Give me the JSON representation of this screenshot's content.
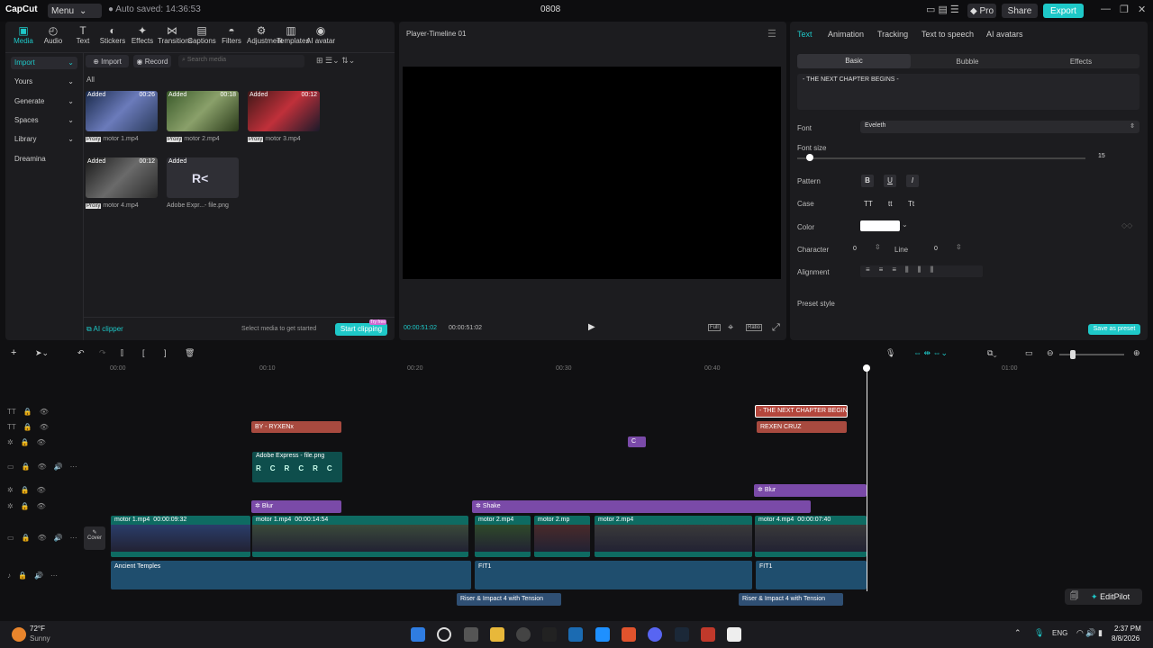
{
  "titlebar": {
    "app_name": "CapCut",
    "menu": "Menu",
    "autosave": "Auto saved: 14:36:53",
    "project": "0808",
    "pro": "Pro",
    "share": "Share",
    "export": "Export"
  },
  "tools": [
    {
      "label": "Media",
      "icon": "media-icon"
    },
    {
      "label": "Audio",
      "icon": "audio-icon"
    },
    {
      "label": "Text",
      "icon": "text-icon"
    },
    {
      "label": "Stickers",
      "icon": "stickers-icon"
    },
    {
      "label": "Effects",
      "icon": "effects-icon"
    },
    {
      "label": "Transitions",
      "icon": "transitions-icon"
    },
    {
      "label": "Captions",
      "icon": "captions-icon"
    },
    {
      "label": "Filters",
      "icon": "filters-icon"
    },
    {
      "label": "Adjustment",
      "icon": "adjustment-icon"
    },
    {
      "label": "Templates",
      "icon": "templates-icon"
    },
    {
      "label": "AI avatar",
      "icon": "ai-avatar-icon"
    }
  ],
  "sidebar": [
    "Import",
    "Yours",
    "Generate",
    "Spaces",
    "Library",
    "Dreamina"
  ],
  "media_toolbar": {
    "import": "Import",
    "record": "Record",
    "search_placeholder": "Search media",
    "filter_all": "All"
  },
  "media": [
    {
      "tag": "Added",
      "dur": "00:26",
      "name": "motor 1.mp4",
      "proxy": "Proxy"
    },
    {
      "tag": "Added",
      "dur": "00:18",
      "name": "motor 2.mp4",
      "proxy": "Proxy"
    },
    {
      "tag": "Added",
      "dur": "00:12",
      "name": "motor 3.mp4",
      "proxy": "Proxy"
    },
    {
      "tag": "Added",
      "dur": "00:12",
      "name": "motor 4.mp4",
      "proxy": "Proxy"
    },
    {
      "tag": "Added",
      "dur": "",
      "name": "Adobe Expr...- file.png",
      "proxy": ""
    }
  ],
  "media_footer": {
    "ai_clipper": "AI clipper",
    "hint": "Select media to get started",
    "start": "Start clipping",
    "badge": "Try free"
  },
  "player": {
    "title": "Player-Timeline 01",
    "current": "00:00:51:02",
    "total": "00:00:51:02",
    "full": "Full",
    "ratio": "Ratio"
  },
  "props": {
    "tabs": [
      "Text",
      "Animation",
      "Tracking",
      "Text to speech",
      "AI avatars"
    ],
    "subtabs": [
      "Basic",
      "Bubble",
      "Effects"
    ],
    "text_value": "- THE NEXT CHAPTER BEGINS -",
    "font_label": "Font",
    "font_value": "Eveleth",
    "size_label": "Font size",
    "size_value": "15",
    "pattern_label": "Pattern",
    "pattern": [
      "B",
      "U",
      "I"
    ],
    "case_label": "Case",
    "case": [
      "TT",
      "tt",
      "Tt"
    ],
    "color_label": "Color",
    "color_value": "#ffffff",
    "char_label": "Character",
    "char_value": "0",
    "line_label": "Line",
    "line_value": "0",
    "align_label": "Alignment",
    "preset_label": "Preset style",
    "save_preset": "Save as preset"
  },
  "ruler": [
    "00:00",
    "00:10",
    "00:20",
    "00:30",
    "00:40",
    "01:00"
  ],
  "tracks": {
    "text1": "- THE NEXT CHAPTER BEGINS -",
    "text2a": "BY - RYXENx",
    "text2b": "REXEN CRUZ",
    "sticker": "C",
    "image": "Adobe Express - file.png",
    "effect1": "Blur",
    "effect2": "Shake",
    "effect3": "Blur",
    "video": [
      {
        "name": "motor 1.mp4",
        "time": "00:00:09:32"
      },
      {
        "name": "motor 1.mp4",
        "time": "00:00:14:54"
      },
      {
        "name": "motor 2.mp4",
        "time": ""
      },
      {
        "name": "motor 2.mp",
        "time": ""
      },
      {
        "name": "motor 2.mp4",
        "time": ""
      },
      {
        "name": "motor 4.mp4",
        "time": "00:00:07:40"
      }
    ],
    "cover": "Cover",
    "audio1": "Ancient Temples",
    "audio2a": "FIT1",
    "audio2b": "FIT1",
    "sfx1": "Riser & Impact 4 with Tension",
    "sfx2": "Riser & Impact 4 with Tension"
  },
  "editpilot": "EditPilot",
  "taskbar": {
    "temp": "72°F",
    "weather": "Sunny",
    "lang": "ENG",
    "time": "2:37 PM",
    "date": "8/8/2026"
  }
}
